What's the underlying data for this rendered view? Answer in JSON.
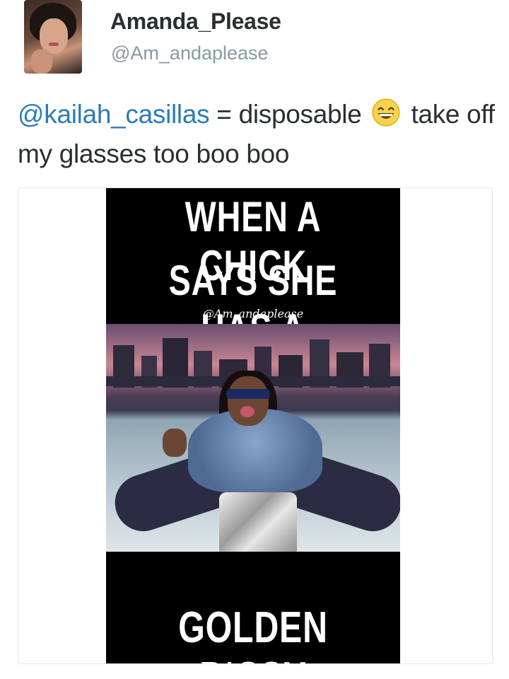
{
  "tweet": {
    "author_name": "Amanda_Please",
    "author_handle": "@Am_andaplease",
    "text_mention": "@kailah_casillas",
    "text_part1": " = disposable ",
    "emoji_name": "grinning-face-with-smiling-eyes-icon",
    "text_part2": " take off my glasses too boo boo"
  },
  "media": {
    "meme_top_line1": "WHEN A CHICK",
    "meme_top_line2": "SAYS SHE HAS A",
    "meme_watermark": "@Am_andaplease",
    "meme_bottom_line": "GOLDEN P*SSY"
  },
  "colors": {
    "link": "#2b7bb9",
    "text": "#292f33",
    "muted": "#8899a6"
  }
}
